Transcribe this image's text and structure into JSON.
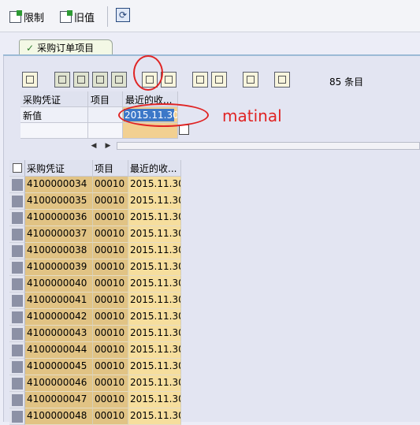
{
  "toolbar": {
    "restrict_label": "限制",
    "old_values_label": "旧值",
    "refresh_icon": "refresh-icon"
  },
  "tab": {
    "label": "采购订单项目"
  },
  "grid_toolbar": {
    "row_count": "85 条目"
  },
  "new_values": {
    "headers": [
      "采购凭证",
      "项目",
      "最近的收..."
    ],
    "row_label": "新值",
    "date_value": "2015.11.30"
  },
  "annotation": {
    "text": "matinal"
  },
  "table": {
    "headers": [
      "采购凭证",
      "项目",
      "最近的收..."
    ],
    "rows": [
      [
        "4100000034",
        "00010",
        "2015.11.30"
      ],
      [
        "4100000035",
        "00010",
        "2015.11.30"
      ],
      [
        "4100000036",
        "00010",
        "2015.11.30"
      ],
      [
        "4100000037",
        "00010",
        "2015.11.30"
      ],
      [
        "4100000038",
        "00010",
        "2015.11.30"
      ],
      [
        "4100000039",
        "00010",
        "2015.11.30"
      ],
      [
        "4100000040",
        "00010",
        "2015.11.30"
      ],
      [
        "4100000041",
        "00010",
        "2015.11.30"
      ],
      [
        "4100000042",
        "00010",
        "2015.11.30"
      ],
      [
        "4100000043",
        "00010",
        "2015.11.30"
      ],
      [
        "4100000044",
        "00010",
        "2015.11.30"
      ],
      [
        "4100000045",
        "00010",
        "2015.11.30"
      ],
      [
        "4100000046",
        "00010",
        "2015.11.30"
      ],
      [
        "4100000047",
        "00010",
        "2015.11.30"
      ],
      [
        "4100000048",
        "00010",
        "2015.11.30"
      ]
    ]
  },
  "colors": {
    "key_column": "#e1c384",
    "date_column": "#f6de9d",
    "highlight_circle": "#e02424"
  }
}
